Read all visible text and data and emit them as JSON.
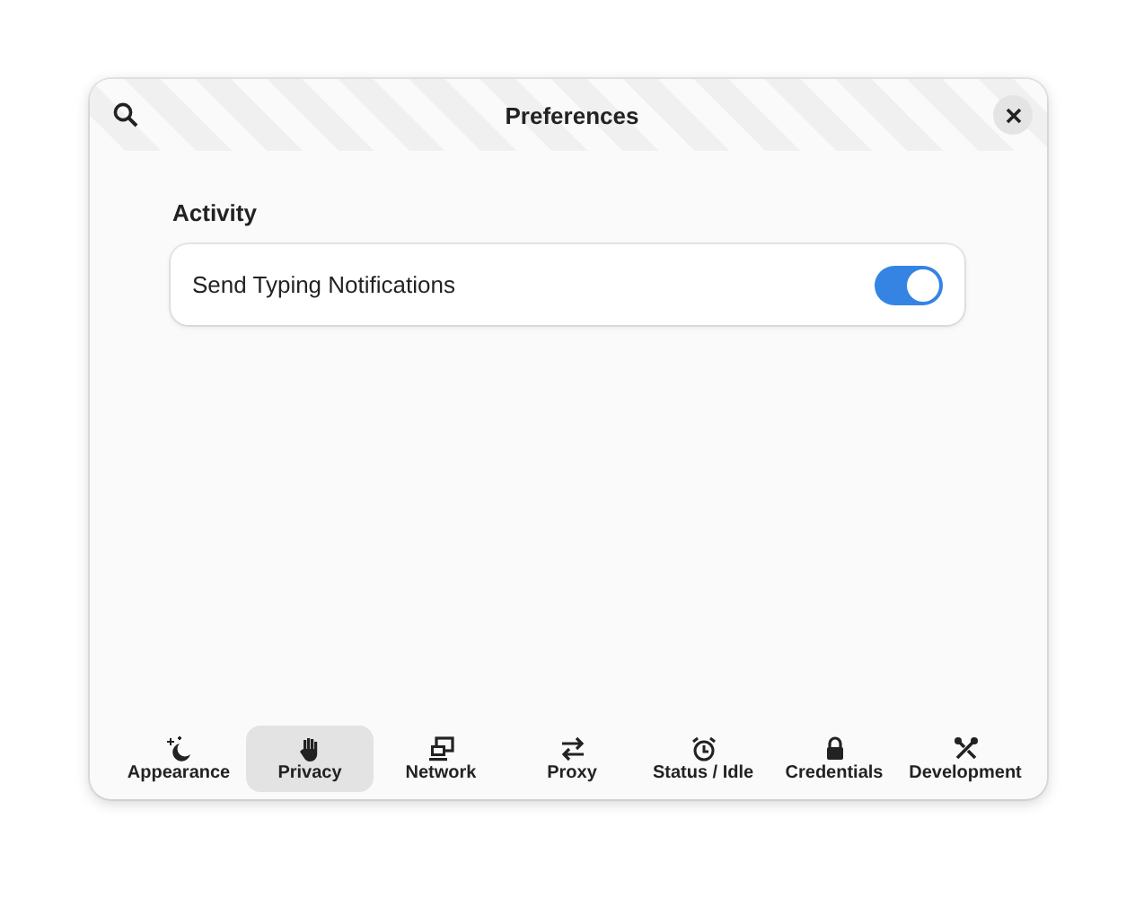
{
  "window": {
    "title": "Preferences"
  },
  "section": {
    "title": "Activity",
    "rows": [
      {
        "label": "Send Typing Notifications",
        "on": true
      }
    ]
  },
  "tabs": [
    {
      "label": "Appearance",
      "selected": false
    },
    {
      "label": "Privacy",
      "selected": true
    },
    {
      "label": "Network",
      "selected": false
    },
    {
      "label": "Proxy",
      "selected": false
    },
    {
      "label": "Status / Idle",
      "selected": false
    },
    {
      "label": "Credentials",
      "selected": false
    },
    {
      "label": "Development",
      "selected": false
    }
  ]
}
